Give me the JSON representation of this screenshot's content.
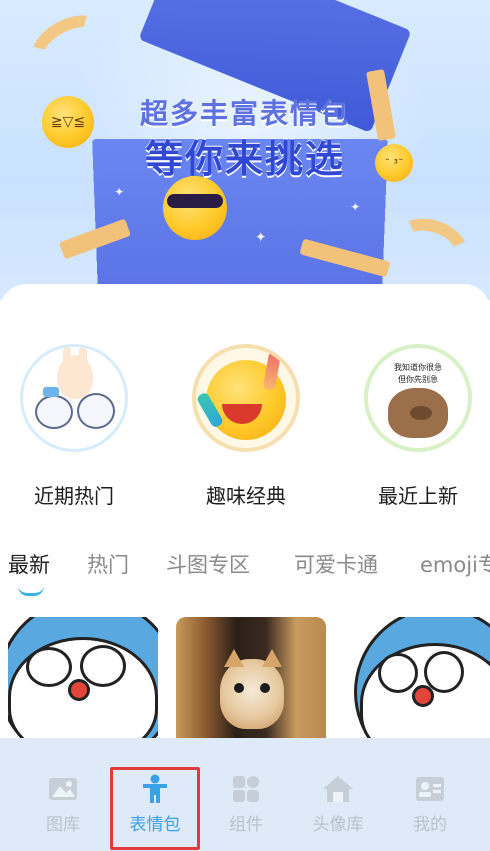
{
  "banner": {
    "headline_line1": "超多丰富表情包",
    "headline_line2": "等你来挑选"
  },
  "categories": [
    {
      "label": "近期热门",
      "icon": "bunny-friends-icon"
    },
    {
      "label": "趣味经典",
      "icon": "laughing-emoji-icon"
    },
    {
      "label": "最近上新",
      "icon": "capybara-icon",
      "sticker_text_1": "我知道你很急",
      "sticker_text_2": "但你先别急"
    }
  ],
  "tabs": [
    {
      "label": "最新",
      "active": true
    },
    {
      "label": "热门",
      "active": false
    },
    {
      "label": "斗图专区",
      "active": false
    },
    {
      "label": "可爱卡通",
      "active": false
    },
    {
      "label": "emoji专",
      "active": false
    }
  ],
  "thumbnails": [
    {
      "name": "doraemon-sticker-1"
    },
    {
      "name": "cat-peeking-photo"
    },
    {
      "name": "doraemon-sticker-2"
    }
  ],
  "bottom_nav": [
    {
      "label": "图库",
      "icon": "gallery-icon",
      "active": false
    },
    {
      "label": "表情包",
      "icon": "person-icon",
      "active": true
    },
    {
      "label": "组件",
      "icon": "widgets-icon",
      "active": false
    },
    {
      "label": "头像库",
      "icon": "home-icon",
      "active": false
    },
    {
      "label": "我的",
      "icon": "profile-card-icon",
      "active": false
    }
  ],
  "colors": {
    "accent": "#3aa1e6",
    "tab_indicator": "#3bb0e9",
    "nav_background": "#dfeaf8",
    "highlight_border": "#e23b3b"
  }
}
